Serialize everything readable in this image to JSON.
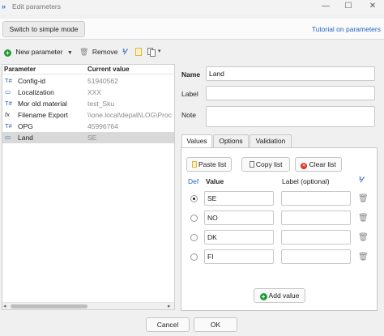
{
  "window": {
    "app_icon": "app-icon",
    "title": "Edit parameters",
    "controls": {
      "minimize": "—",
      "maximize": "☐",
      "close": "✕"
    }
  },
  "topbar": {
    "simple_mode": "Switch to simple mode",
    "tutorial": "Tutorial on parameters"
  },
  "toolbar": {
    "new_parameter": "New parameter",
    "remove": "Remove",
    "icons": [
      "add-icon",
      "chevron-down-icon",
      "trash-icon",
      "sort-icon",
      "paste-icon",
      "copy-icon"
    ]
  },
  "parameters": {
    "columns": [
      "Parameter",
      "Current value"
    ],
    "rows": [
      {
        "icon": "T#",
        "name": "Config-id",
        "value": "51940562",
        "selected": false
      },
      {
        "icon": "▭",
        "name": "Localization",
        "value": "XXX",
        "selected": false
      },
      {
        "icon": "T#",
        "name": "Mor old material",
        "value": "test_Sku",
        "selected": false
      },
      {
        "icon": "fx",
        "name": "Filename Export",
        "value": "\\\\one.local\\depall\\LOG\\Proc",
        "selected": false
      },
      {
        "icon": "T#",
        "name": "OPG",
        "value": "45996764",
        "selected": false
      },
      {
        "icon": "▭",
        "name": "Land",
        "value": "SE",
        "selected": true
      }
    ],
    "scroll_left": "◂",
    "scroll_right": "▸"
  },
  "form": {
    "name_label": "Name",
    "name_value": "Land",
    "label_label": "Label",
    "label_value": "",
    "note_label": "Note",
    "note_value": ""
  },
  "tabs": [
    "Values",
    "Options",
    "Validation"
  ],
  "values_tab": {
    "paste_list": "Paste list",
    "copy_list": "Copy list",
    "clear_list": "Clear list",
    "col_def": "Def",
    "col_value": "Value",
    "col_label": "Label (optional)",
    "rows": [
      {
        "value": "SE",
        "label": "",
        "default": true
      },
      {
        "value": "NO",
        "label": "",
        "default": false
      },
      {
        "value": "DK",
        "label": "",
        "default": false
      },
      {
        "value": "FI",
        "label": "",
        "default": false
      }
    ],
    "add_value": "Add value"
  },
  "footer": {
    "cancel": "Cancel",
    "ok": "OK"
  },
  "colors": {
    "accent_link": "#2166c4",
    "green": "#1e9b3a",
    "red": "#d43a2f",
    "selected_row": "#d9d9d9"
  }
}
